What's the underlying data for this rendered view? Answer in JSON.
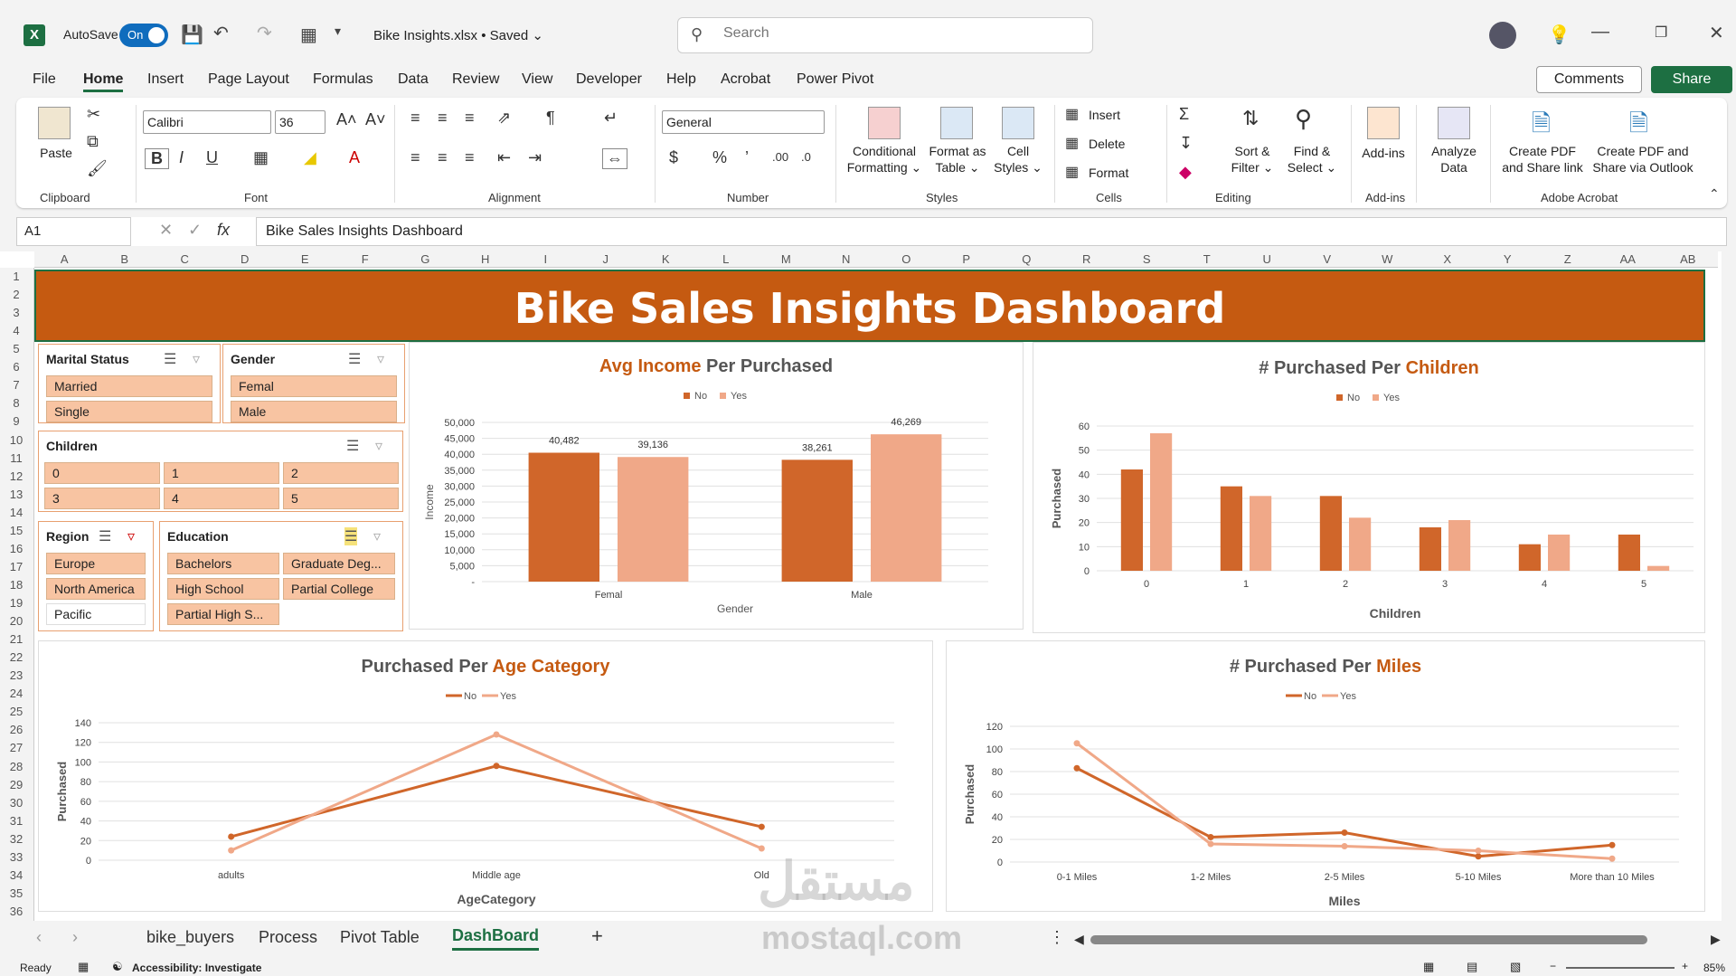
{
  "titlebar": {
    "autosave_label": "AutoSave",
    "autosave_state": "On",
    "doc_title": "Bike Insights.xlsx • Saved ⌄",
    "search_placeholder": "Search"
  },
  "menu": [
    "File",
    "Home",
    "Insert",
    "Page Layout",
    "Formulas",
    "Data",
    "Review",
    "View",
    "Developer",
    "Help",
    "Acrobat",
    "Power Pivot"
  ],
  "menu_active": "Home",
  "buttons": {
    "comments": "Comments",
    "share": "Share"
  },
  "ribbon": {
    "font_name": "Calibri",
    "font_size": "36",
    "number_format": "General",
    "groups": [
      "Clipboard",
      "Font",
      "Alignment",
      "Number",
      "Styles",
      "Cells",
      "Editing",
      "Add-ins",
      "Adobe Acrobat"
    ],
    "paste": "Paste",
    "cond_format": [
      "Conditional",
      "Formatting ⌄"
    ],
    "format_table": [
      "Format as",
      "Table ⌄"
    ],
    "cell_styles": [
      "Cell",
      "Styles ⌄"
    ],
    "insert": "Insert",
    "delete": "Delete",
    "format": "Format",
    "sort_filter": [
      "Sort &",
      "Filter ⌄"
    ],
    "find_select": [
      "Find &",
      "Select ⌄"
    ],
    "addins": "Add-ins",
    "analyze": [
      "Analyze",
      "Data"
    ],
    "pdf_link": [
      "Create PDF",
      "and Share link"
    ],
    "pdf_outlook": [
      "Create PDF and",
      "Share via Outlook"
    ]
  },
  "formula": {
    "namebox": "A1",
    "content": "Bike Sales Insights Dashboard"
  },
  "columns": [
    "A",
    "B",
    "C",
    "D",
    "E",
    "F",
    "G",
    "H",
    "I",
    "J",
    "K",
    "L",
    "M",
    "N",
    "O",
    "P",
    "Q",
    "R",
    "S",
    "T",
    "U",
    "V",
    "W",
    "X",
    "Y",
    "Z",
    "AA",
    "AB"
  ],
  "rows": [
    "1",
    "2",
    "3",
    "4",
    "5",
    "6",
    "7",
    "8",
    "9",
    "10",
    "11",
    "12",
    "13",
    "14",
    "15",
    "16",
    "17",
    "18",
    "19",
    "20",
    "21",
    "22",
    "23",
    "24",
    "25",
    "26",
    "27",
    "28",
    "29",
    "30",
    "31",
    "32",
    "33",
    "34",
    "35",
    "36"
  ],
  "dashboard_title": "Bike Sales Insights Dashboard",
  "slicers": {
    "marital": {
      "title": "Marital Status",
      "items": [
        "Married",
        "Single"
      ]
    },
    "gender": {
      "title": "Gender",
      "items": [
        "Femal",
        "Male"
      ]
    },
    "children": {
      "title": "Children",
      "items": [
        "0",
        "1",
        "2",
        "3",
        "4",
        "5"
      ]
    },
    "region": {
      "title": "Region",
      "items": [
        "Europe",
        "North America",
        "Pacific"
      ]
    },
    "education": {
      "title": "Education",
      "items": [
        "Bachelors",
        "Graduate Deg...",
        "High School",
        "Partial College",
        "Partial High S..."
      ]
    }
  },
  "colors": {
    "no": "#d0662a",
    "yes": "#f0a888",
    "accent": "#c55a11",
    "excel_green": "#1d6f42"
  },
  "chart_data": [
    {
      "type": "bar",
      "title": "Avg Income Per Purchased",
      "title_parts": [
        "Avg Income",
        " Per Purchased"
      ],
      "categories": [
        "Femal",
        "Male"
      ],
      "series": [
        {
          "name": "No",
          "values": [
            40482,
            38261
          ]
        },
        {
          "name": "Yes",
          "values": [
            39136,
            46269
          ]
        }
      ],
      "data_labels": [
        [
          "40,482",
          "38,261"
        ],
        [
          "39,136",
          "46,269"
        ]
      ],
      "xlabel": "Gender",
      "ylabel": "Income",
      "ylim": [
        0,
        50000
      ],
      "yticks": [
        "-",
        "5,000",
        "10,000",
        "15,000",
        "20,000",
        "25,000",
        "30,000",
        "35,000",
        "40,000",
        "45,000",
        "50,000"
      ],
      "legend": "top"
    },
    {
      "type": "bar",
      "title": "# Purchased Per  Children",
      "title_parts": [
        "# Purchased Per ",
        " Children"
      ],
      "categories": [
        "0",
        "1",
        "2",
        "3",
        "4",
        "5"
      ],
      "series": [
        {
          "name": "No",
          "values": [
            42,
            35,
            31,
            18,
            11,
            15
          ]
        },
        {
          "name": "Yes",
          "values": [
            57,
            31,
            22,
            21,
            15,
            2
          ]
        }
      ],
      "xlabel": "Children",
      "ylabel": "Purchased",
      "ylim": [
        0,
        60
      ],
      "yticks": [
        "0",
        "10",
        "20",
        "30",
        "40",
        "50",
        "60"
      ],
      "legend": "top"
    },
    {
      "type": "line",
      "title": "Purchased Per Age Category",
      "title_parts": [
        "Purchased Per ",
        "Age Category"
      ],
      "categories": [
        "adults",
        "Middle age",
        "Old"
      ],
      "series": [
        {
          "name": "No",
          "values": [
            24,
            96,
            34
          ]
        },
        {
          "name": "Yes",
          "values": [
            10,
            128,
            12
          ]
        }
      ],
      "xlabel": "AgeCategory",
      "ylabel": "Purchased",
      "ylim": [
        0,
        140
      ],
      "yticks": [
        "0",
        "20",
        "40",
        "60",
        "80",
        "100",
        "120",
        "140"
      ],
      "legend": "top"
    },
    {
      "type": "line",
      "title": "# Purchased Per Miles",
      "title_parts": [
        "# Purchased Per ",
        "Miles"
      ],
      "categories": [
        "0-1 Miles",
        "1-2 Miles",
        "2-5 Miles",
        "5-10 Miles",
        "More than 10 Miles"
      ],
      "series": [
        {
          "name": "No",
          "values": [
            83,
            22,
            26,
            5,
            15
          ]
        },
        {
          "name": "Yes",
          "values": [
            105,
            16,
            14,
            10,
            3
          ]
        }
      ],
      "xlabel": "Miles",
      "ylabel": "Purchased",
      "ylim": [
        0,
        120
      ],
      "yticks": [
        "0",
        "20",
        "40",
        "60",
        "80",
        "100",
        "120"
      ],
      "legend": "top"
    }
  ],
  "sheets": [
    "bike_buyers",
    "Process",
    "Pivot Table",
    "DashBoard"
  ],
  "sheet_active": "DashBoard",
  "status": {
    "ready": "Ready",
    "accessibility": "Accessibility: Investigate",
    "zoom": "85%"
  },
  "watermark": {
    "arabic": "مستقل",
    "latin": "mostaql.com"
  }
}
